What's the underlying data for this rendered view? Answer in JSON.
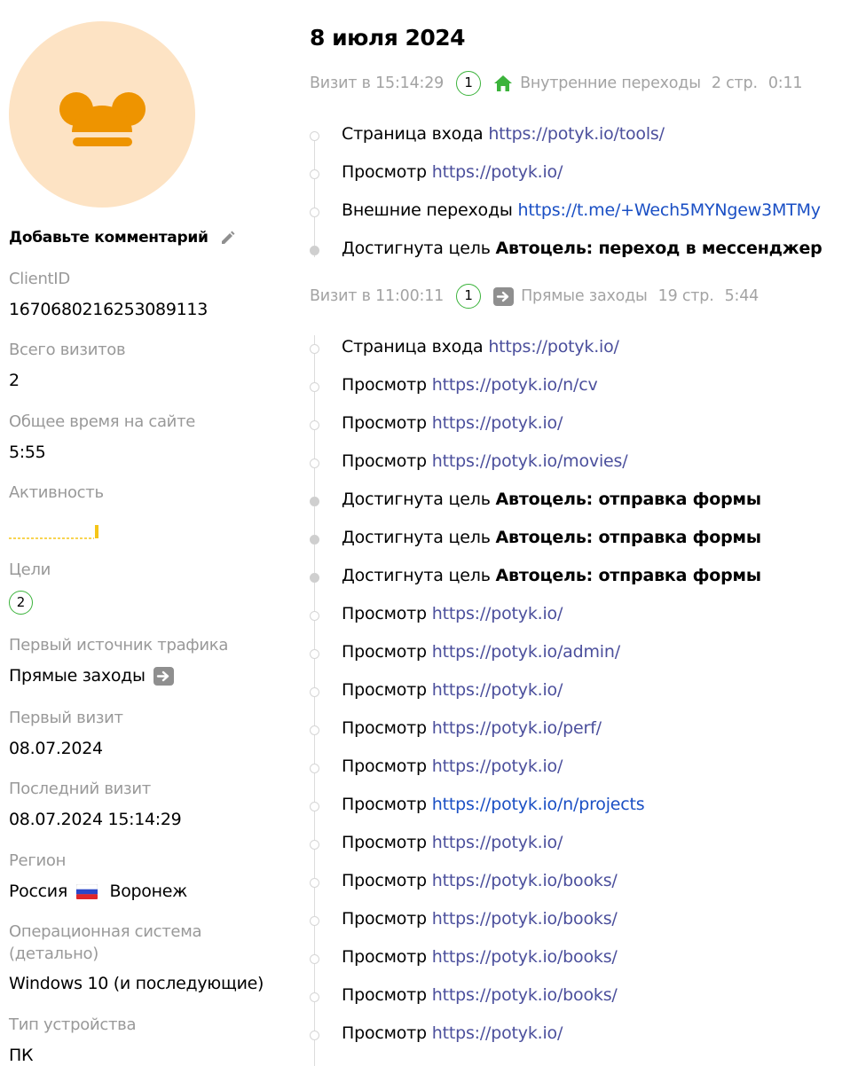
{
  "profile": {
    "comment_label": "Добавьте комментарий",
    "fields": [
      {
        "label": "ClientID",
        "value": "1670680216253089113"
      },
      {
        "label": "Всего визитов",
        "value": "2"
      },
      {
        "label": "Общее время на сайте",
        "value": "5:55"
      },
      {
        "label": "Активность"
      },
      {
        "label": "Цели",
        "value": "2"
      },
      {
        "label": "Первый источник трафика",
        "value": "Прямые заходы"
      },
      {
        "label": "Первый визит",
        "value": "08.07.2024"
      },
      {
        "label": "Последний визит",
        "value": "08.07.2024 15:14:29"
      },
      {
        "label": "Регион",
        "country": "Россия",
        "city": "Воронеж"
      },
      {
        "label": "Операционная система",
        "label_line2": "(детально)",
        "value": "Windows 10 (и последующие)"
      },
      {
        "label": "Тип устройства",
        "value": "ПК"
      }
    ],
    "colors": {
      "avatar_bg": "#fde3c4",
      "avatar_fg": "#ee9400",
      "goal_ring": "#3bb33b",
      "activity": "#f5c518"
    }
  },
  "timeline": {
    "date": "8 июля 2024",
    "visits": [
      {
        "title": "Визит в 15:14:29",
        "goals": "1",
        "source_icon": "house-icon",
        "source": "Внутренние переходы",
        "pages": "2 стр.",
        "duration": "0:11",
        "events": [
          {
            "type": "Страница входа",
            "link": "https://potyk.io/tools/"
          },
          {
            "type": "Просмотр",
            "link": "https://potyk.io/"
          },
          {
            "type": "Внешние переходы",
            "link": "https://t.me/+Wech5MYNgew3MTMy"
          },
          {
            "type": "Достигнута цель",
            "goal": "Автоцель: переход в мессенджер"
          }
        ]
      },
      {
        "title": "Визит в 11:00:11",
        "goals": "1",
        "source_icon": "arrow-right-icon",
        "source": "Прямые заходы",
        "pages": "19 стр.",
        "duration": "5:44",
        "events": [
          {
            "type": "Страница входа",
            "link": "https://potyk.io/"
          },
          {
            "type": "Просмотр",
            "link": "https://potyk.io/n/cv"
          },
          {
            "type": "Просмотр",
            "link": "https://potyk.io/"
          },
          {
            "type": "Просмотр",
            "link": "https://potyk.io/movies/"
          },
          {
            "type": "Достигнута цель",
            "goal": "Автоцель: отправка формы"
          },
          {
            "type": "Достигнута цель",
            "goal": "Автоцель: отправка формы"
          },
          {
            "type": "Достигнута цель",
            "goal": "Автоцель: отправка формы"
          },
          {
            "type": "Просмотр",
            "link": "https://potyk.io/"
          },
          {
            "type": "Просмотр",
            "link": "https://potyk.io/admin/"
          },
          {
            "type": "Просмотр",
            "link": "https://potyk.io/"
          },
          {
            "type": "Просмотр",
            "link": "https://potyk.io/perf/"
          },
          {
            "type": "Просмотр",
            "link": "https://potyk.io/"
          },
          {
            "type": "Просмотр",
            "link": "https://potyk.io/n/projects"
          },
          {
            "type": "Просмотр",
            "link": "https://potyk.io/"
          },
          {
            "type": "Просмотр",
            "link": "https://potyk.io/books/"
          },
          {
            "type": "Просмотр",
            "link": "https://potyk.io/books/"
          },
          {
            "type": "Просмотр",
            "link": "https://potyk.io/books/"
          },
          {
            "type": "Просмотр",
            "link": "https://potyk.io/books/"
          },
          {
            "type": "Просмотр",
            "link": "https://potyk.io/"
          }
        ]
      }
    ],
    "colors": {
      "link": "#4b4f9c",
      "link_active": "#1a4fc4",
      "meta_text": "#a3a3a3",
      "house": "#3bb33b"
    }
  }
}
